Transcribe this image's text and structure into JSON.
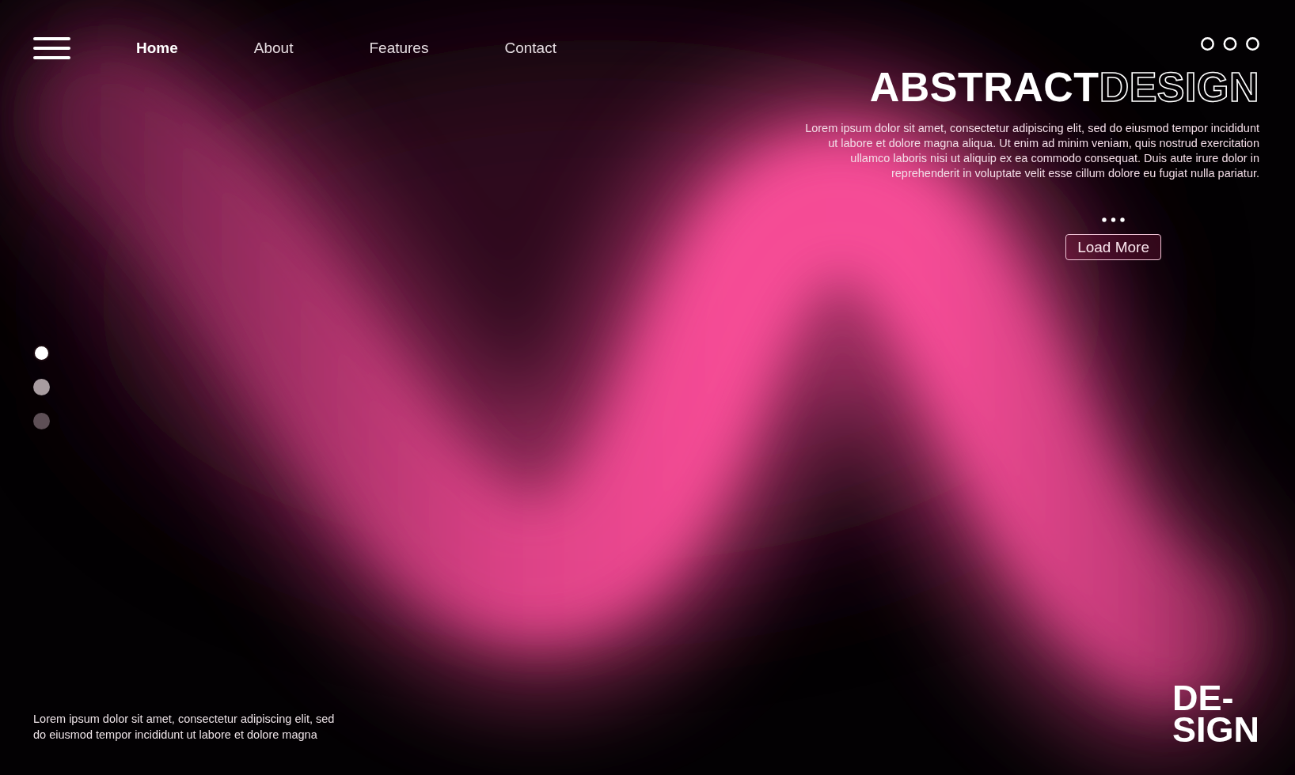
{
  "nav": [
    {
      "label": "Home",
      "selected": true
    },
    {
      "label": "About",
      "selected": false
    },
    {
      "label": "Features",
      "selected": false
    },
    {
      "label": "Contact",
      "selected": false
    }
  ],
  "hero": {
    "title": [
      {
        "text": "ABSTRACT",
        "kind": "solid"
      },
      {
        "text": "DESIGN",
        "kind": "outline"
      }
    ],
    "body_lines": [
      "Lorem ipsum dolor sit amet, consectetur adipiscing elit, sed do eiusmod tempor incididunt",
      "ut labore et dolore magna aliqua. Ut enim ad minim veniam, quis nostrud exercitation",
      "ullamco laboris nisi ut aliquip ex ea commodo consequat. Duis aute irure dolor in",
      "reprehenderit in voluptate velit esse cillum dolore eu fugiat nulla pariatur."
    ],
    "button": "Load More"
  },
  "pager": [
    {
      "selected": true,
      "color": "#ffffff"
    },
    {
      "selected": false,
      "color": "#a89ca0"
    },
    {
      "selected": false,
      "color": "#5e4f56"
    }
  ],
  "footer": {
    "text_lines": [
      "Lorem ipsum dolor sit amet, consectetur adipiscing elit, sed",
      "do eiusmod tempor incididunt ut labore et dolore magna"
    ],
    "mark_lines": [
      "DE-",
      "SIGN"
    ]
  }
}
